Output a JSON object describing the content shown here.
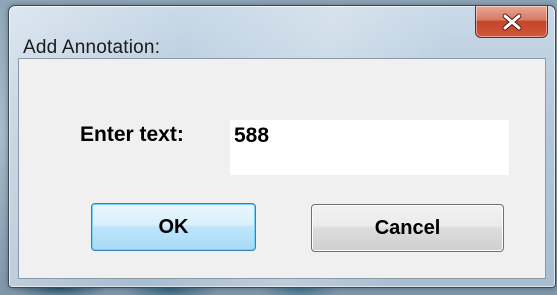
{
  "dialog": {
    "title": "Add Annotation:",
    "close_icon": "close-x-icon"
  },
  "form": {
    "label": "Enter text:",
    "input_value": "588"
  },
  "buttons": {
    "ok_label": "OK",
    "cancel_label": "Cancel"
  },
  "colors": {
    "close_button": "#c8482d",
    "ok_border": "#3c7fb1",
    "client_bg": "#f0f0f0"
  }
}
